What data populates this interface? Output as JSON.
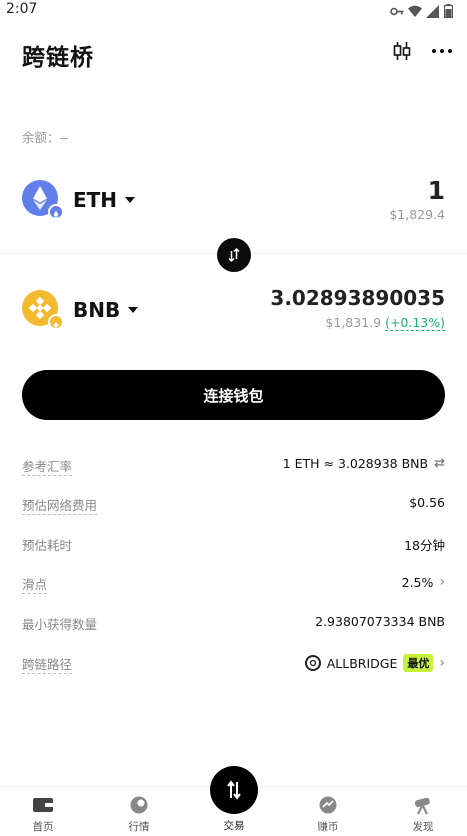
{
  "status_bar": {
    "time": "2:07"
  },
  "header": {
    "title": "跨链桥"
  },
  "balance": {
    "text": "余额：--"
  },
  "from_token": {
    "symbol": "ETH",
    "amount": "1",
    "usd": "$1,829.4",
    "icon": "ethereum-icon",
    "color": "#627eea"
  },
  "to_token": {
    "symbol": "BNB",
    "amount": "3.02893890035",
    "usd": "$1,831.9",
    "change": "(+0.13%)",
    "icon": "bnb-icon",
    "color": "#f3ba2f"
  },
  "connect": {
    "label": "连接钱包"
  },
  "details": {
    "rate": {
      "label": "参考汇率",
      "value": "1 ETH ≈ 3.028938 BNB",
      "icon": "swap-arrows-icon"
    },
    "fee": {
      "label": "预估网络费用",
      "value": "$0.56"
    },
    "time": {
      "label": "预估耗时",
      "value": "18分钟"
    },
    "slippage": {
      "label": "滑点",
      "value": "2.5%"
    },
    "min_received": {
      "label": "最小获得数量",
      "value": "2.93807073334 BNB"
    },
    "route": {
      "label": "跨链路径",
      "value": "ALLBRIDGE",
      "badge": "最优"
    }
  },
  "nav": {
    "home": "首页",
    "market": "行情",
    "trade": "交易",
    "earn": "赚币",
    "discover": "发现"
  },
  "colors": {
    "accent_green": "#1bb36b",
    "best_badge": "#c7f23a",
    "primary": "#000000"
  }
}
